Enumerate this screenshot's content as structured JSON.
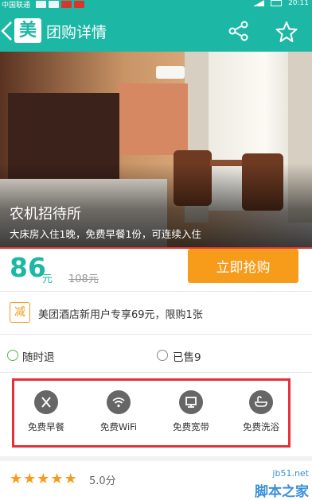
{
  "status_bar": {
    "carrier": "中国联通",
    "time": "20:11"
  },
  "header": {
    "logo_text": "美",
    "title": "团购详情"
  },
  "hotel": {
    "name": "农机招待所",
    "description": "大床房入住1晚，免费早餐1份，可连续入住"
  },
  "price": {
    "current": "86",
    "unit": "元",
    "original": "108元",
    "buy_label": "立即抢购"
  },
  "promo": {
    "badge": "减",
    "text": "美团酒店新用户专享69元，限购1张"
  },
  "info": {
    "refund": "随时退",
    "sold": "已售9"
  },
  "amenities": [
    {
      "label": "免费早餐",
      "icon": "utensils-icon"
    },
    {
      "label": "免费WiFi",
      "icon": "wifi-icon"
    },
    {
      "label": "免费宽带",
      "icon": "monitor-icon"
    },
    {
      "label": "免费洗浴",
      "icon": "bathtub-icon"
    }
  ],
  "rating": {
    "stars": 5,
    "score": "5.0分"
  },
  "watermark": {
    "url": "jb51.net",
    "name": "脚本之家"
  },
  "colors": {
    "accent": "#1cb7a5",
    "buy_button": "#f79b1a",
    "highlight_box": "#e2313b"
  }
}
